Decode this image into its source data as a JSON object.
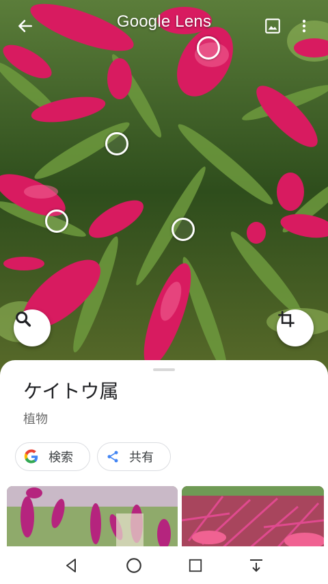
{
  "app": {
    "title": "Google Lens"
  },
  "topbar": {
    "back_icon": "arrow-back-icon",
    "gallery_icon": "image-icon",
    "more_icon": "more-vert-icon"
  },
  "result": {
    "title": "ケイトウ属",
    "subtitle": "植物"
  },
  "actions": [
    {
      "label": "検索",
      "icon": "google-g-icon"
    },
    {
      "label": "共有",
      "icon": "share-icon"
    }
  ],
  "colors": {
    "flower": "#d81b60",
    "leaf": "#3f6b2a",
    "google_blue": "#4285f4",
    "google_red": "#ea4335",
    "google_yellow": "#fbbc05",
    "google_green": "#34a853"
  },
  "navbar": {
    "back": "nav-back-icon",
    "home": "nav-home-icon",
    "recents": "nav-recents-icon",
    "notifications": "nav-notification-pull-icon"
  }
}
